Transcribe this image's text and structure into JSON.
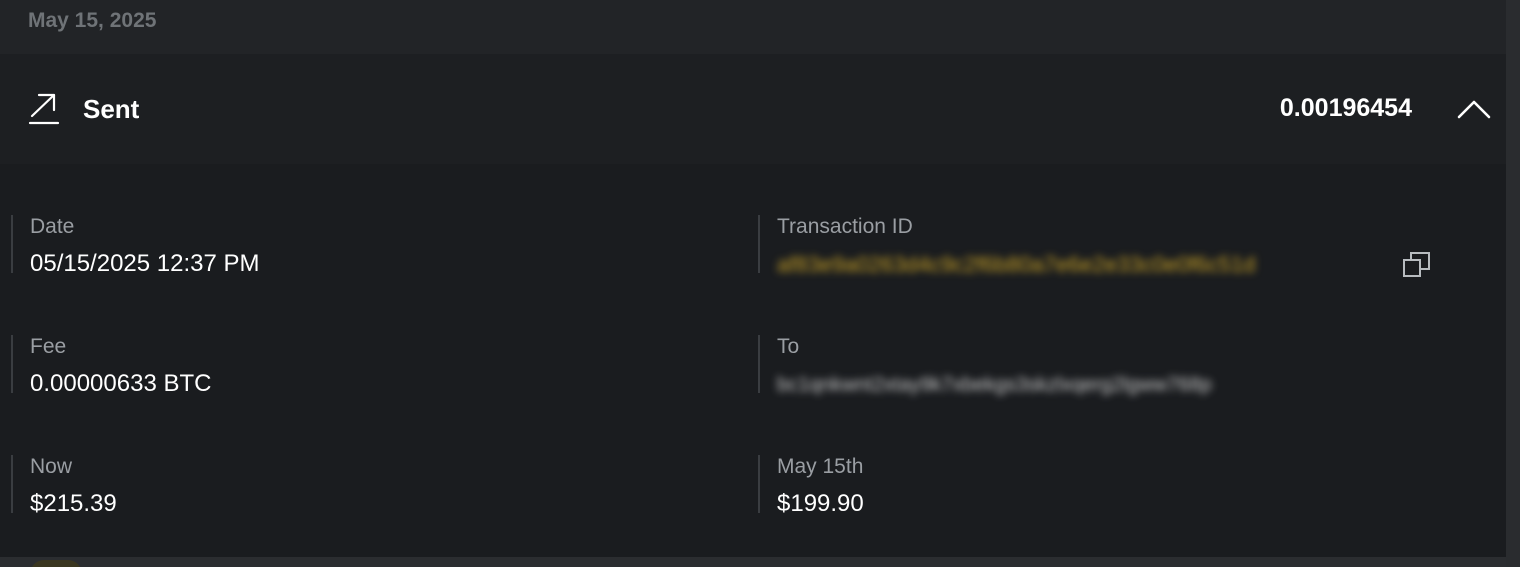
{
  "date_header": "May 15, 2025",
  "transaction": {
    "type_label": "Sent",
    "amount": "0.00196454"
  },
  "icons": {
    "sent": "arrow-up-right-icon",
    "collapse": "chevron-up-icon",
    "copy": "copy-icon"
  },
  "details": {
    "date": {
      "label": "Date",
      "value": "05/15/2025 12:37 PM"
    },
    "transaction_id": {
      "label": "Transaction ID",
      "value": "af83e9a0263d4c9c2f6b80a7e6e2e33c0e0f6c51d"
    },
    "fee": {
      "label": "Fee",
      "value": "0.00000633 BTC"
    },
    "to": {
      "label": "To",
      "value": "bc1qnkwnt2xtay9k7xbekgs3skzlxqerg2lgww768p"
    },
    "now": {
      "label": "Now",
      "value": "$215.39"
    },
    "then": {
      "label": "May 15th",
      "value": "$199.90"
    }
  },
  "colors": {
    "background": "#1a1c1f",
    "accent_gold": "#c9a227",
    "label_gray": "#9a9ea3",
    "text_white": "#ffffff"
  }
}
